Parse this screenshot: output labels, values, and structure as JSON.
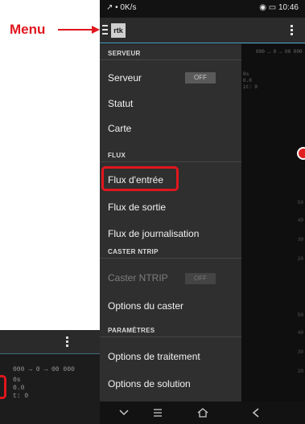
{
  "callout": {
    "label": "Menu"
  },
  "status_bar": {
    "left": "↗ • 0K/s",
    "right": "◉ ▭ 10:46"
  },
  "app": {
    "logo": "rtk"
  },
  "drawer": {
    "sections": [
      {
        "header": "SERVEUR",
        "items": [
          {
            "label": "Serveur",
            "toggle": "OFF",
            "enabled": true
          },
          {
            "label": "Statut",
            "enabled": true
          },
          {
            "label": "Carte",
            "enabled": true
          }
        ]
      },
      {
        "header": "FLUX",
        "items": [
          {
            "label": "Flux d'entrée",
            "enabled": true,
            "highlighted": true
          },
          {
            "label": "Flux de sortie",
            "enabled": true
          },
          {
            "label": "Flux de journalisation",
            "enabled": true
          }
        ]
      },
      {
        "header": "CASTER NTRIP",
        "items": [
          {
            "label": "Caster NTRIP",
            "toggle": "OFF",
            "enabled": false
          },
          {
            "label": "Options du caster",
            "enabled": true
          }
        ]
      },
      {
        "header": "PARAMÈTRES",
        "items": [
          {
            "label": "Options de traitement",
            "enabled": true
          },
          {
            "label": "Options de solution",
            "enabled": true
          }
        ]
      }
    ]
  },
  "ghost": {
    "line1": "0s",
    "line2": "0.0",
    "line3": "t: 0"
  },
  "background": {
    "top_text": "000 → 0 → 00 000",
    "line1": "0s",
    "line2": "0.0",
    "line3": "it: 0",
    "ticks": [
      "50",
      "40",
      "30",
      "20",
      "50",
      "40",
      "30",
      "20"
    ]
  },
  "nav": {
    "icons": [
      "chevron-down-icon",
      "menu-lines-icon",
      "home-icon",
      "back-icon"
    ]
  },
  "colors": {
    "accent_red": "#e0161d",
    "app_bar_border": "#4aa9c4"
  }
}
